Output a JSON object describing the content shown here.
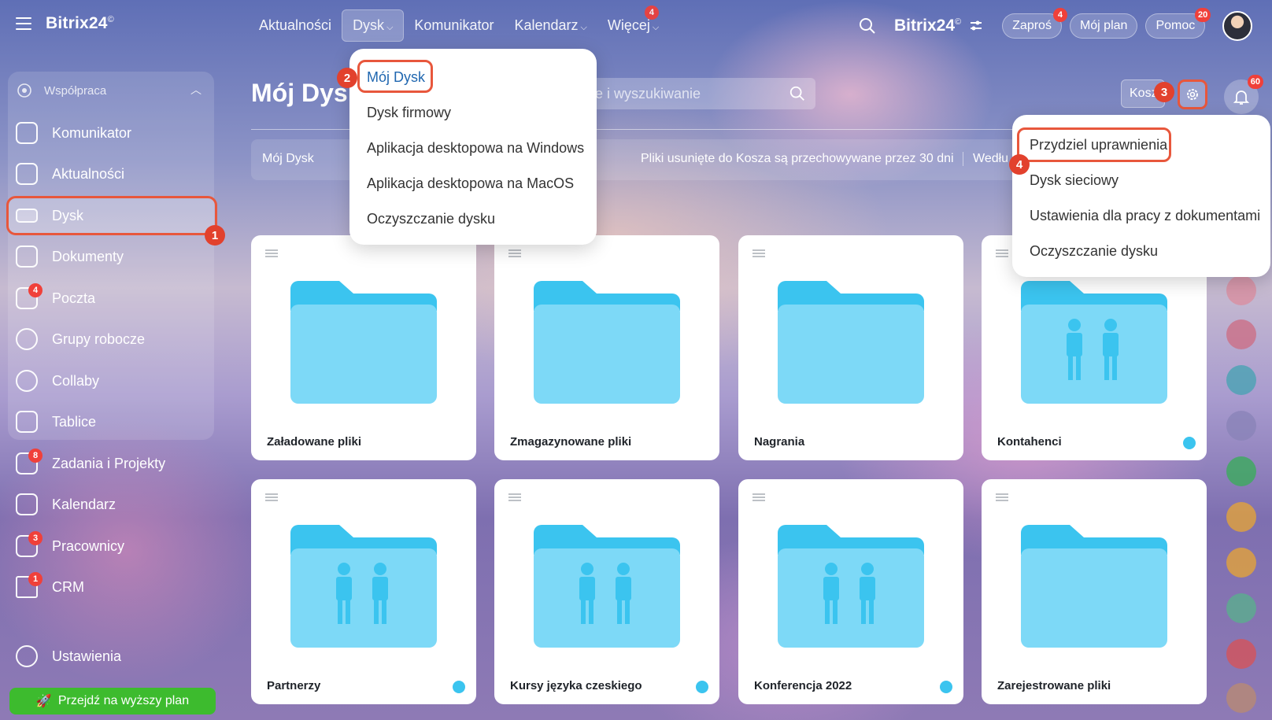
{
  "app": {
    "logo": "Bitrix24",
    "logo_mark": "©",
    "brand": "Bitrix24",
    "brand_mark": "©"
  },
  "topnav": [
    {
      "label": "Aktualności"
    },
    {
      "label": "Dysk",
      "active": true
    },
    {
      "label": "Komunikator"
    },
    {
      "label": "Kalendarz"
    },
    {
      "label": "Więcej",
      "badge": "4"
    }
  ],
  "header_right": {
    "invite": "Zaproś",
    "invite_badge": "4",
    "plan": "Mój plan",
    "help": "Pomoc",
    "help_badge": "20"
  },
  "sidebar": {
    "group": "Współpraca",
    "items": [
      {
        "label": "Komunikator"
      },
      {
        "label": "Aktualności"
      },
      {
        "label": "Dysk",
        "active": true
      },
      {
        "label": "Dokumenty"
      },
      {
        "label": "Poczta",
        "badge": "4"
      },
      {
        "label": "Grupy robocze"
      },
      {
        "label": "Collaby"
      },
      {
        "label": "Tablice"
      },
      {
        "label": "Zadania i Projekty",
        "badge": "8"
      },
      {
        "label": "Kalendarz"
      },
      {
        "label": "Pracownicy",
        "badge": "3"
      },
      {
        "label": "CRM",
        "badge": "1"
      }
    ],
    "settings": "Ustawienia",
    "upgrade": "Przejdź na wyższy plan"
  },
  "page": {
    "title": "Mój Dysk",
    "search_placeholder": "ie i wyszukiwanie",
    "subbar_tab": "Mój Dysk",
    "trash_note": "Pliki usunięte do Kosza są przechowywane przez 30 dni",
    "sort_label": "Wedłu",
    "trash_button": "Kosz",
    "notifications_badge": "60"
  },
  "dysk_menu": [
    "Mój Dysk",
    "Dysk firmowy",
    "Aplikacja desktopowa na Windows",
    "Aplikacja desktopowa na MacOS",
    "Oczyszczanie dysku"
  ],
  "settings_menu": [
    "Przydziel uprawnienia",
    "Dysk sieciowy",
    "Ustawienia dla pracy z dokumentami",
    "Oczyszczanie dysku"
  ],
  "folders": [
    {
      "name": "Załadowane pliki",
      "people": false,
      "shared": false
    },
    {
      "name": "Zmagazynowane pliki",
      "people": false,
      "shared": false
    },
    {
      "name": "Nagrania",
      "people": false,
      "shared": false
    },
    {
      "name": "Kontahenci",
      "people": true,
      "shared": true
    },
    {
      "name": "Partnerzy",
      "people": true,
      "shared": true
    },
    {
      "name": "Kursy języka czeskiego",
      "people": true,
      "shared": true
    },
    {
      "name": "Konferencja 2022",
      "people": true,
      "shared": true
    },
    {
      "name": "Zarejestrowane pliki",
      "people": false,
      "shared": false
    }
  ],
  "steps": [
    "1",
    "2",
    "3",
    "4"
  ],
  "colors": {
    "accent": "#e8573c",
    "folder": "#7dd9f7",
    "folder_tab": "#3bc4ef",
    "upgrade": "#3dbb2e",
    "badge": "#f0403a",
    "link": "#2067b0"
  }
}
